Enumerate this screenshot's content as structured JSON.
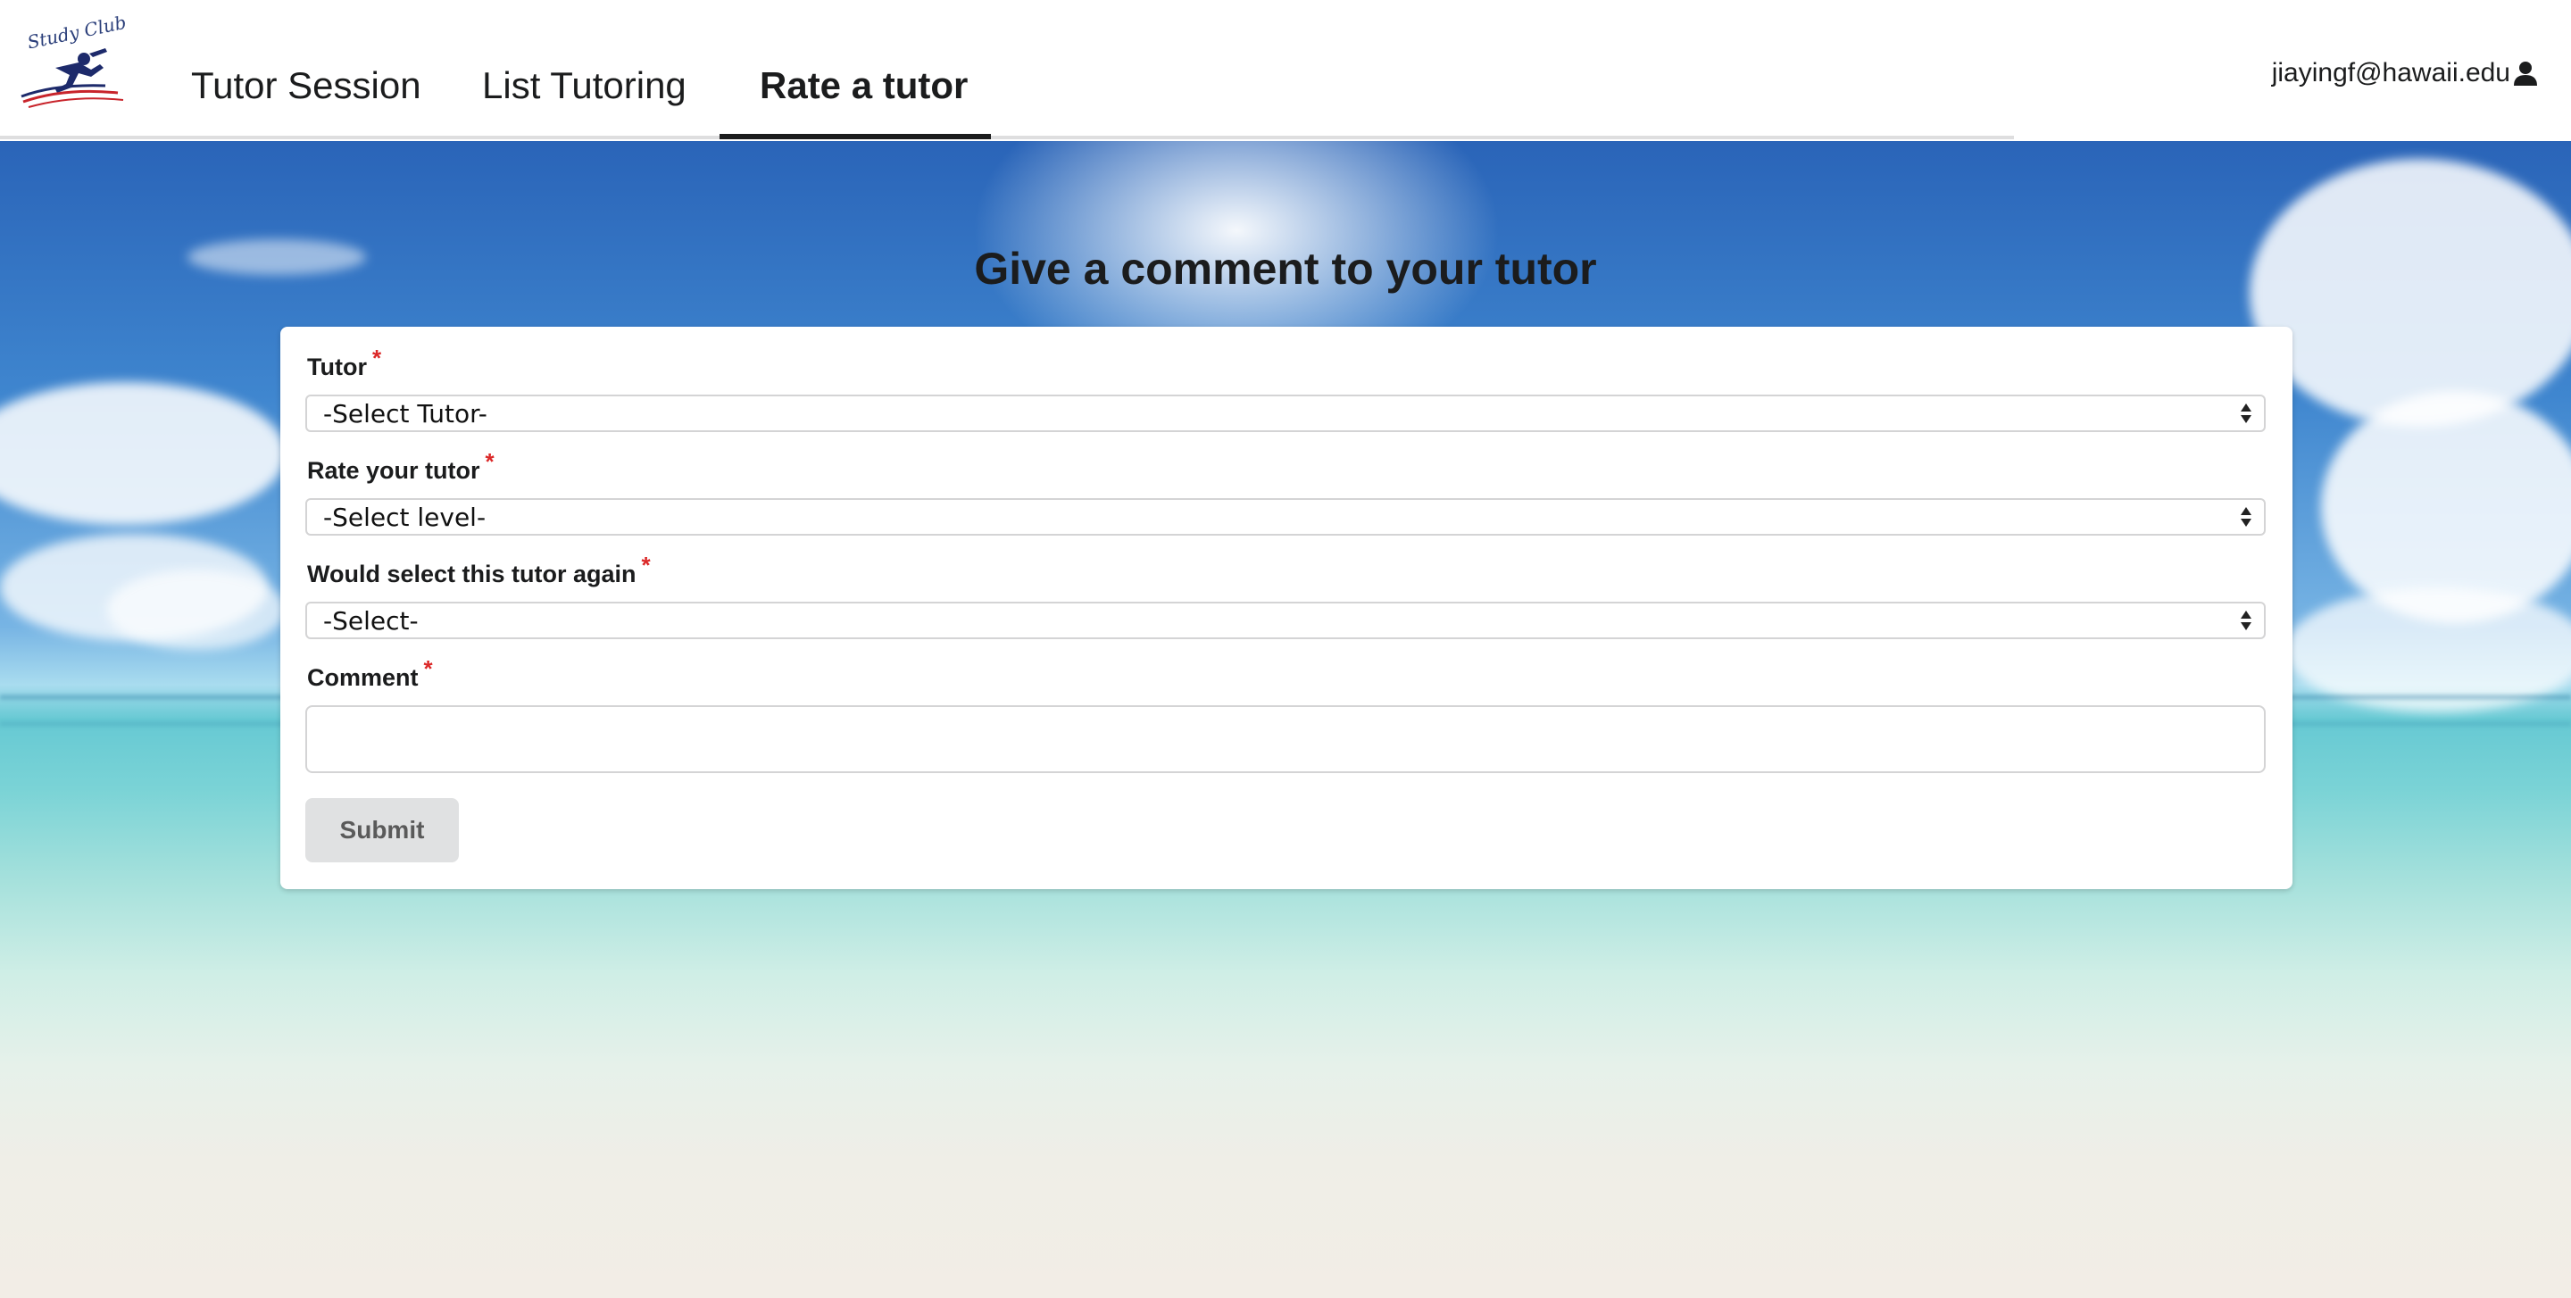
{
  "brand": {
    "logo_text": "Study Club",
    "logo_icon": "graduate-runner-logo"
  },
  "nav": {
    "items": [
      {
        "label": "Tutor Session",
        "active": false
      },
      {
        "label": "List Tutoring",
        "active": false
      },
      {
        "label": "Rate a tutor",
        "active": true
      }
    ],
    "user_email": "jiayingf@hawaii.edu",
    "user_icon": "user-icon"
  },
  "page": {
    "title": "Give a comment to your tutor"
  },
  "form": {
    "fields": [
      {
        "label": "Tutor",
        "required_mark": "*",
        "value": "-Select Tutor-",
        "icon": "select-arrows-icon"
      },
      {
        "label": "Rate your tutor",
        "required_mark": "*",
        "value": "-Select level-",
        "icon": "select-arrows-icon"
      },
      {
        "label": "Would select this tutor again",
        "required_mark": "*",
        "value": "-Select-",
        "icon": "select-arrows-icon"
      }
    ],
    "comment": {
      "label": "Comment",
      "required_mark": "*",
      "value": ""
    },
    "submit_label": "Submit"
  },
  "colors": {
    "required": "#db2828",
    "button_bg": "#e0e1e2",
    "nav_active": "#1b1c1d"
  }
}
